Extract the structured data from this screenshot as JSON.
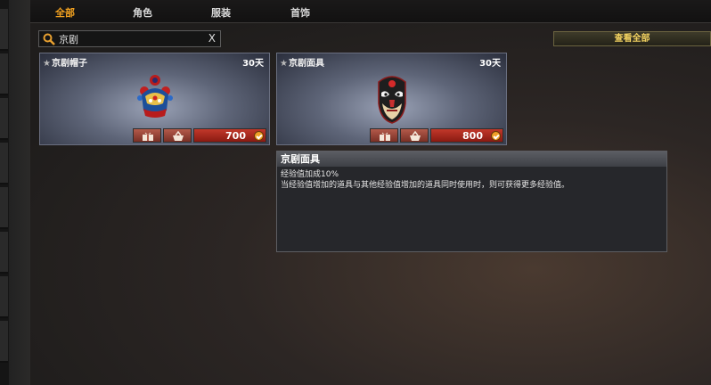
{
  "tabs": [
    {
      "label": "全部",
      "active": true
    },
    {
      "label": "角色",
      "active": false
    },
    {
      "label": "服装",
      "active": false
    },
    {
      "label": "首饰",
      "active": false
    }
  ],
  "search": {
    "value": "京剧",
    "clear_label": "X",
    "icon": "search-icon"
  },
  "view_all_label": "查看全部",
  "items": [
    {
      "name": "京剧帽子",
      "duration": "30天",
      "price": "700",
      "icon": "opera-hat-icon"
    },
    {
      "name": "京剧面具",
      "duration": "30天",
      "price": "800",
      "icon": "opera-mask-icon"
    }
  ],
  "tooltip": {
    "title": "京剧面具",
    "lines": [
      "经验值加成10%",
      "当经验值增加的道具与其他经验值增加的道具同时使用时，则可获得更多经验值。"
    ]
  },
  "colors": {
    "active_tab": "#f0a020",
    "view_all_text": "#f2d260",
    "price_bg": "#c2382a"
  }
}
